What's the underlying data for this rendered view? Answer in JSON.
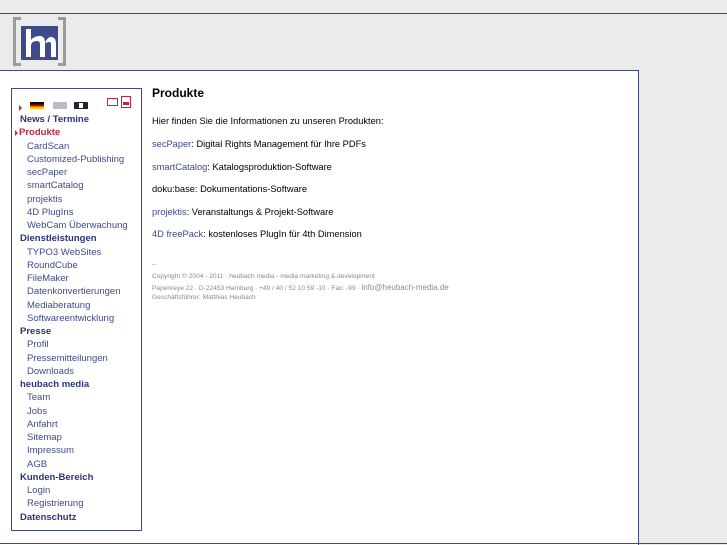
{
  "header": {
    "logo_text": "hm"
  },
  "language": {
    "flags": [
      "de",
      "en",
      "fr"
    ],
    "icons": [
      "mail-icon",
      "pdf-icon"
    ]
  },
  "nav": [
    {
      "label": "News / Termine",
      "type": "section"
    },
    {
      "label": "Produkte",
      "type": "active"
    },
    {
      "label": "CardScan",
      "type": "sub"
    },
    {
      "label": "Customized-Publishing",
      "type": "sub"
    },
    {
      "label": "secPaper",
      "type": "sub"
    },
    {
      "label": "smartCatalog",
      "type": "sub"
    },
    {
      "label": "projektis",
      "type": "sub"
    },
    {
      "label": "4D PlugIns",
      "type": "sub"
    },
    {
      "label": "WebCam Überwachung",
      "type": "sub"
    },
    {
      "label": "Dienstleistungen",
      "type": "section"
    },
    {
      "label": "TYPO3 WebSites",
      "type": "sub"
    },
    {
      "label": "RoundCube",
      "type": "sub"
    },
    {
      "label": "FileMaker",
      "type": "sub"
    },
    {
      "label": "Datenkonvertierungen",
      "type": "sub"
    },
    {
      "label": "Mediaberatung",
      "type": "sub"
    },
    {
      "label": "Softwareentwicklung",
      "type": "sub"
    },
    {
      "label": "Presse",
      "type": "section"
    },
    {
      "label": "Profil",
      "type": "sub"
    },
    {
      "label": "Pressemitteilungen",
      "type": "sub"
    },
    {
      "label": "Downloads",
      "type": "sub"
    },
    {
      "label": "heubach media",
      "type": "section"
    },
    {
      "label": "Team",
      "type": "sub"
    },
    {
      "label": "Jobs",
      "type": "sub"
    },
    {
      "label": "Anfahrt",
      "type": "sub"
    },
    {
      "label": "Sitemap",
      "type": "sub"
    },
    {
      "label": "Impressum",
      "type": "sub"
    },
    {
      "label": "AGB",
      "type": "sub"
    },
    {
      "label": "Kunden-Bereich",
      "type": "section"
    },
    {
      "label": "Login",
      "type": "sub"
    },
    {
      "label": "Registrierung",
      "type": "sub"
    },
    {
      "label": "Datenschutz",
      "type": "section"
    }
  ],
  "main": {
    "title": "Produkte",
    "intro": "Hier finden Sie die Informationen zu unseren Produkten:",
    "products": [
      {
        "name": "secPaper",
        "desc": ": Digital Rights Management für Ihre PDFs"
      },
      {
        "name": "smartCatalog",
        "desc": ": Katalogsproduktion-Software"
      },
      {
        "name": "doku:base",
        "desc": ": Dokumentations-Software",
        "plain": true
      },
      {
        "name": "projektis",
        "desc": ": Veranstaltungs & Projekt-Software"
      },
      {
        "name": "4D freePack",
        "desc": ": kostenloses PlugIn für 4th Dimension"
      }
    ]
  },
  "footer": {
    "separator": "--",
    "copyright": "Copyright © 2004 - 2011 · heubach media - media marketing & development",
    "address": "Papenreye 22 · D-22453 Hamburg · +49 / 40 / 52 10 59 -10 · Fax: -99 · ",
    "email": "info@heubach-media.de",
    "manager": "Geschäftsführer: Matthias Heubach"
  },
  "colors": {
    "nav_blue": "#3f4a8a",
    "active_red": "#c2253f",
    "background": "#ebebeb"
  }
}
